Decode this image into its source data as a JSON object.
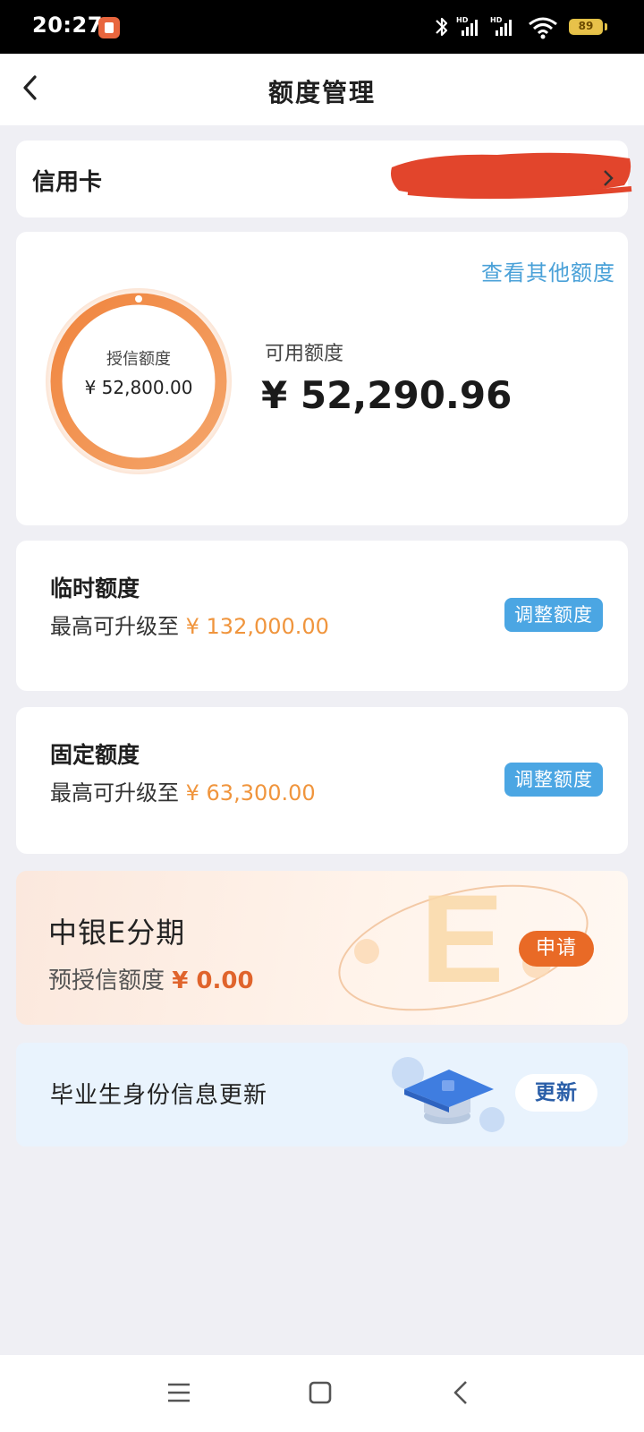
{
  "status_bar": {
    "time": "20:27",
    "battery": "89"
  },
  "header": {
    "title": "额度管理"
  },
  "card_type": {
    "label": "信用卡"
  },
  "limit": {
    "view_other_label": "查看其他额度",
    "credit_label": "授信额度",
    "credit_value": "¥ 52,800.00",
    "available_label": "可用额度",
    "available_value": "¥ 52,290.96"
  },
  "temporary": {
    "title": "临时额度",
    "desc_prefix": "最高可升级至",
    "amount": "¥ 132,000.00",
    "button": "调整额度"
  },
  "fixed": {
    "title": "固定额度",
    "desc_prefix": "最高可升级至",
    "amount": "¥ 63,300.00",
    "button": "调整额度"
  },
  "installment": {
    "title": "中银E分期",
    "pre_label": "预授信额度",
    "pre_value": "¥ 0.00",
    "button": "申请"
  },
  "graduate": {
    "label": "毕业生身份信息更新",
    "button": "更新"
  },
  "colors": {
    "accent_blue": "#4ba6e3",
    "link_blue": "#4aa1d8",
    "orange": "#f0953d",
    "apply_orange": "#e96a26",
    "redaction_red": "#e2452c"
  }
}
